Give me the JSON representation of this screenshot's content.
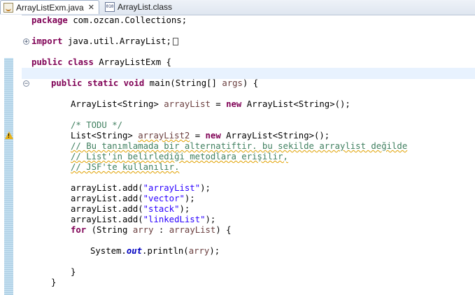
{
  "tabs": [
    {
      "label": "ArrayListExm.java",
      "active": true,
      "close": "✕"
    },
    {
      "label": "ArrayList.class",
      "active": false,
      "class_badge": "010"
    }
  ],
  "code": {
    "l1_kw": "package",
    "l1_rest": " com.ozcan.Collections;",
    "l2_kw": "import",
    "l2_rest": " java.util.ArrayList;",
    "l3_kw1": "public",
    "l3_kw2": "class",
    "l3_rest": " ArrayListExm {",
    "l4_kw1": "public",
    "l4_kw2": "static",
    "l4_kw3": "void",
    "l4_name": " main(String[] ",
    "l4_var": "args",
    "l4_end": ") {",
    "l5_a": "ArrayList<String> ",
    "l5_var": "arrayList",
    "l5_b": " = ",
    "l5_kw": "new",
    "l5_c": " ArrayList<String>();",
    "l6_cm": "/* TODU */",
    "l7_a": "List<String> ",
    "l7_var": "arrayList2",
    "l7_b": " = ",
    "l7_kw": "new",
    "l7_c": " ArrayList<String>();",
    "l8_cm": "// Bu tanımlamada bir alternatiftir. bu sekilde arraylist değilde",
    "l9_cm": "// List'in belirlediği metodlara erişilir,",
    "l10_cm": "// JSF'te kullanılır.",
    "adds": [
      {
        "pre": "arrayList.add(",
        "str": "\"arrayList\"",
        "post": ");"
      },
      {
        "pre": "arrayList.add(",
        "str": "\"vector\"",
        "post": ");"
      },
      {
        "pre": "arrayList.add(",
        "str": "\"stack\"",
        "post": ");"
      },
      {
        "pre": "arrayList.add(",
        "str": "\"linkedList\"",
        "post": ");"
      }
    ],
    "l15_kw": "for",
    "l15_a": " (String ",
    "l15_var": "arry",
    "l15_b": " : ",
    "l15_var2": "arrayList",
    "l15_c": ") {",
    "l16_a": "System.",
    "l16_fld": "out",
    "l16_b": ".println(",
    "l16_var": "arry",
    "l16_c": ");",
    "l17": "}",
    "l18": "}"
  },
  "colors": {
    "keyword": "#7f0055",
    "string": "#2a00ff",
    "comment": "#3f7f5f",
    "current_line": "#e8f2fe"
  },
  "gutter": {
    "fold_collapsed": "+",
    "fold_expanded": "−",
    "warning": "!"
  }
}
